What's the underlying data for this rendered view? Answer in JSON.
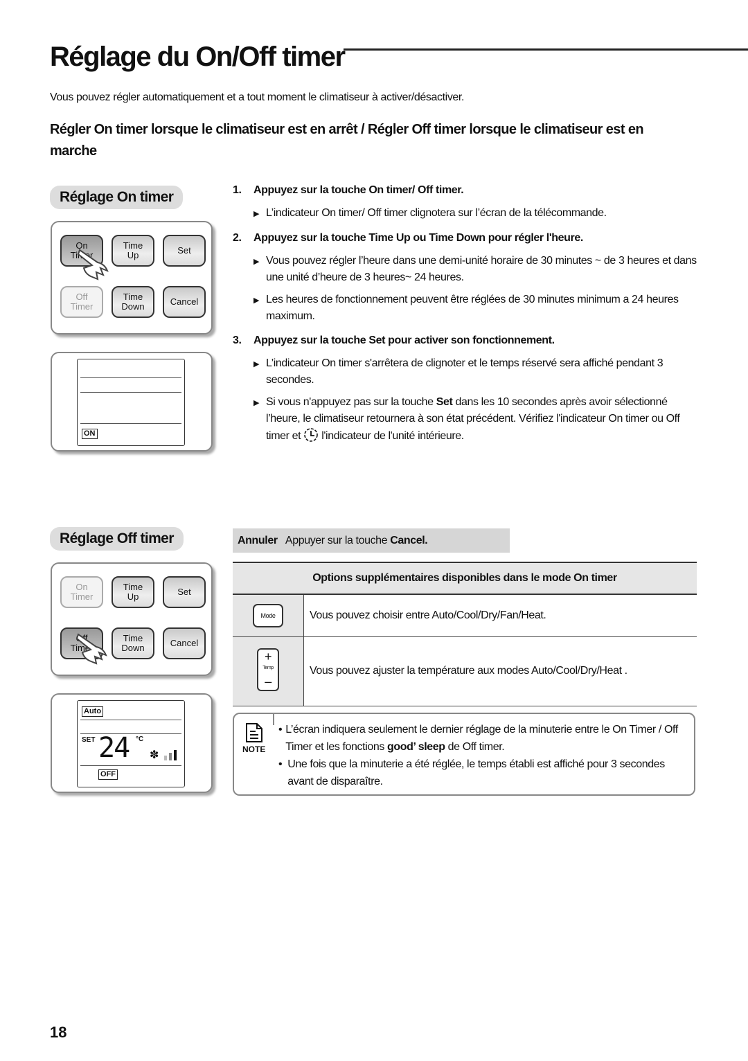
{
  "page": {
    "title": "Réglage du On/Off timer",
    "intro": "Vous pouvez régler automatiquement et a tout moment le climatiseur à activer/désactiver.",
    "subheading": "Régler On timer  lorsque le climatiseur est en arrêt / Régler Off timer lorsque le climatiseur est en marche",
    "page_number": "18"
  },
  "on_timer_panel": {
    "label": "Réglage On timer",
    "buttons": {
      "on_timer": "On\nTimer",
      "time_up": "Time\nUp",
      "set": "Set",
      "off_timer": "Off\nTimer",
      "time_down": "Time\nDown",
      "cancel": "Cancel"
    },
    "display_tag": "ON"
  },
  "off_timer_panel": {
    "label": "Réglage Off timer",
    "buttons": {
      "on_timer": "On\nTimer",
      "time_up": "Time\nUp",
      "set": "Set",
      "off_timer": "Off\nTimer",
      "time_down": "Time\nDown",
      "cancel": "Cancel"
    },
    "display": {
      "mode_tag": "Auto",
      "set_label": "SET",
      "temperature": "24",
      "unit": "°C",
      "off_tag": "OFF"
    }
  },
  "steps": [
    {
      "num": "1.",
      "heading": "Appuyez sur la touche On timer/ Off timer.",
      "bullets": [
        "L’indicateur On timer/ Off timer clignotera sur l’écran de la télécommande."
      ]
    },
    {
      "num": "2.",
      "heading": "Appuyez sur la touche Time Up ou Time Down pour régler l'heure.",
      "bullets": [
        "Vous pouvez régler l’heure dans une demi-unité horaire de 30 minutes ~ de 3 heures et dans une unité d’heure de 3 heures~ 24 heures.",
        "Les heures de fonctionnement peuvent être réglées de 30 minutes minimum a 24 heures maximum."
      ]
    },
    {
      "num": "3.",
      "heading": "Appuyez sur la touche Set pour activer son fonctionnement.",
      "bullets": [
        "L’indicateur On timer s'arrêtera de clignoter et le temps réservé sera affiché pendant 3 secondes."
      ],
      "bullet_set": {
        "before": "Si vous n'appuyez pas sur la touche ",
        "bold": "Set",
        "after": " dans les 10 secondes après avoir sélectionné l’heure, le climatiseur retournera à son état précédent. Vérifiez l'indicateur On timer ou Off timer et ",
        "tail": " l'indicateur de l'unité intérieure."
      }
    }
  ],
  "cancel_bar": {
    "label": "Annuler",
    "text": "Appuyer sur la touche ",
    "key": "Cancel."
  },
  "options_table": {
    "header": "Options supplémentaires disponibles dans le mode On timer",
    "rows": [
      {
        "key_label": "Mode",
        "text": "Vous pouvez choisir entre Auto/Cool/Dry/Fan/Heat."
      },
      {
        "key_label": "Temp",
        "plus": "+",
        "minus": "–",
        "text": "Vous pouvez ajuster la température aux modes Auto/Cool/Dry/Heat ."
      }
    ]
  },
  "note": {
    "label": "NOTE",
    "item1_before": "L’écran indiquera seulement le dernier réglage de la minuterie entre le On Timer / Off Timer et les fonctions ",
    "item1_bold": "good’ sleep",
    "item1_after": " de Off timer.",
    "item2": "Une fois que la minuterie a été réglée, le temps établi est affiché pour 3 secondes avant de disparaître."
  }
}
